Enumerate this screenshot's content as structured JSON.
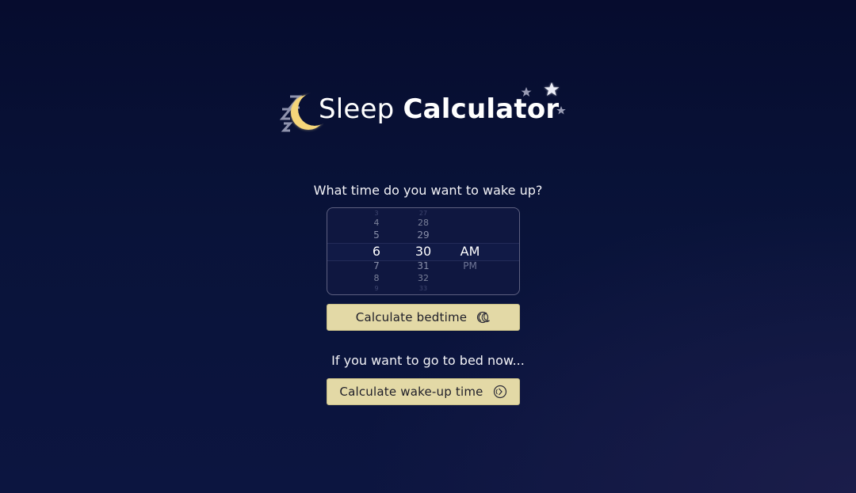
{
  "header": {
    "title_light": "Sleep",
    "title_bold": "Calculator",
    "logo_icon": "crescent-moon-zzz-icon",
    "stars_icon": "stars-icon"
  },
  "wake_question": "What time do you want to wake up?",
  "picker": {
    "hours": [
      "3",
      "4",
      "5",
      "6",
      "7",
      "8",
      "9"
    ],
    "minutes": [
      "27",
      "28",
      "29",
      "30",
      "31",
      "32",
      "33"
    ],
    "ampm": [
      "AM",
      "PM"
    ],
    "selected": {
      "hour": "6",
      "minute": "30",
      "ampm": "AM"
    }
  },
  "bedtime_button": {
    "label": "Calculate bedtime",
    "icon": "moon-sleep-icon"
  },
  "now_question": "If you want to go to bed now...",
  "wakeup_button": {
    "label": "Calculate wake-up time",
    "icon": "wake-clock-icon"
  },
  "colors": {
    "background_top": "#060c2e",
    "background_bottom": "#0c1540",
    "button_bg": "#e3d9a6",
    "moon": "#f5d67a"
  }
}
